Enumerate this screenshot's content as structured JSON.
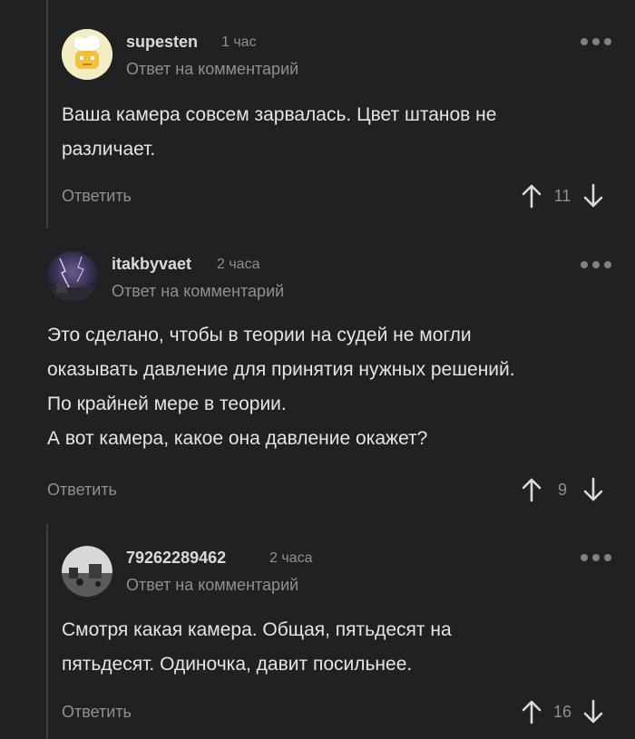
{
  "comments": [
    {
      "username": "supesten",
      "time": "1 час",
      "reply_to": "Ответ на комментарий",
      "lines": [
        "Ваша камера совсем зарвалась. Цвет штанов не",
        "различает."
      ],
      "reply_label": "Ответить",
      "votes": "11"
    },
    {
      "username": "itakbyvaet",
      "time": "2 часа",
      "reply_to": "Ответ на комментарий",
      "lines": [
        "Это сделано, чтобы в теории на судей не могли",
        "оказывать давление для принятия нужных решений.",
        "По крайней мере в теории.",
        "А вот камера, какое она давление окажет?"
      ],
      "reply_label": "Ответить",
      "votes": "9"
    },
    {
      "username": "79262289462",
      "time": "2 часа",
      "reply_to": "Ответ на комментарий",
      "lines": [
        "Смотря какая камера. Общая, пятьдесят на",
        "пятьдесят. Одиночка, давит посильнее."
      ],
      "reply_label": "Ответить",
      "votes": "16"
    }
  ],
  "colors": {
    "background": "#1f2123",
    "thread_line": "#3a3d40",
    "muted_text": "#8d9094",
    "username": "#d9dadb"
  },
  "icons": {
    "more": "more-dots-icon",
    "upvote": "arrow-up-icon",
    "downvote": "arrow-down-icon"
  }
}
